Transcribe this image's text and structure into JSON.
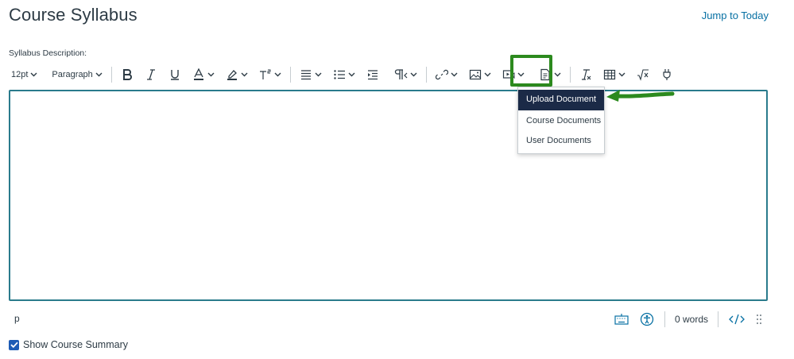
{
  "header": {
    "title": "Course Syllabus",
    "jump_link": "Jump to Today"
  },
  "editor": {
    "label": "Syllabus Description:",
    "toolbar": {
      "font_size": "12pt",
      "block_format": "Paragraph",
      "icons": [
        "bold-icon",
        "italic-icon",
        "underline-icon",
        "text-color-icon",
        "highlight-icon",
        "superscript-icon",
        "align-icon",
        "list-icon",
        "indent-icon",
        "text-direction-icon",
        "link-icon",
        "image-icon",
        "media-icon",
        "document-icon",
        "clear-formatting-icon",
        "table-icon",
        "equation-icon",
        "apps-icon"
      ]
    },
    "documents_menu": {
      "items": [
        "Upload Document",
        "Course Documents",
        "User Documents"
      ],
      "active_index": 0
    },
    "status": {
      "path": "p",
      "word_count": "0 words"
    },
    "colors": {
      "border": "#2a7b8c",
      "highlight_box": "#2c8a1e",
      "menu_active_bg": "#1b2a47",
      "link": "#0770a3"
    }
  },
  "summary": {
    "label": "Show Course Summary",
    "checked": true
  }
}
